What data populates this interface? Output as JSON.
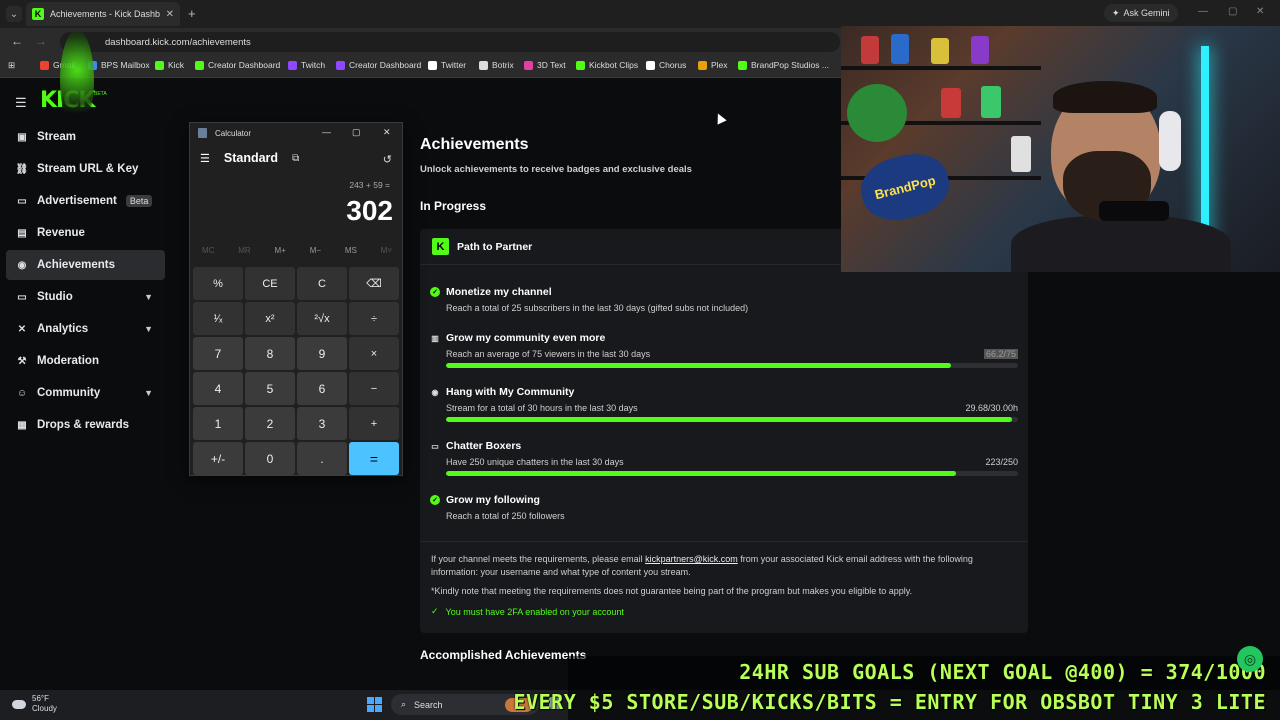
{
  "browser": {
    "tab_title": "Achievements - Kick Dashboard",
    "tab_close": "✕",
    "new_tab": "+",
    "ask_gemini": "Ask Gemini",
    "url": "dashboard.kick.com/achievements",
    "bookmarks": [
      {
        "label": "Gmail",
        "color": "#ea4335"
      },
      {
        "label": "BPS Mailbox",
        "color": "#4285f4"
      },
      {
        "label": "Kick",
        "color": "#53fc18"
      },
      {
        "label": "Creator Dashboard",
        "color": "#53fc18"
      },
      {
        "label": "Twitch",
        "color": "#9146ff"
      },
      {
        "label": "Creator Dashboard",
        "color": "#9146ff"
      },
      {
        "label": "Twitter",
        "color": "#ffffff"
      },
      {
        "label": "Botrix",
        "color": "#dddddd"
      },
      {
        "label": "3D Text",
        "color": "#e040a0"
      },
      {
        "label": "Kickbot Clips",
        "color": "#53fc18"
      },
      {
        "label": "Chorus",
        "color": "#ffffff"
      },
      {
        "label": "Plex",
        "color": "#e5a00d"
      },
      {
        "label": "BrandPop Studios ...",
        "color": "#53fc18"
      }
    ]
  },
  "sidebar": {
    "logo": "KICK",
    "logo_tag": "BETA",
    "items": [
      {
        "label": "Stream",
        "icon": "broadcast-icon",
        "glyph": "▣"
      },
      {
        "label": "Stream URL & Key",
        "icon": "link-icon",
        "glyph": "⛓"
      },
      {
        "label": "Advertisement",
        "icon": "ad-icon",
        "glyph": "▭",
        "badge": "Beta"
      },
      {
        "label": "Revenue",
        "icon": "wallet-icon",
        "glyph": "▤"
      },
      {
        "label": "Achievements",
        "icon": "trophy-icon",
        "glyph": "◉"
      },
      {
        "label": "Studio",
        "icon": "monitor-icon",
        "glyph": "▭"
      },
      {
        "label": "Analytics",
        "icon": "analytics-icon",
        "glyph": "✕"
      },
      {
        "label": "Moderation",
        "icon": "hammer-icon",
        "glyph": "⚒"
      },
      {
        "label": "Community",
        "icon": "users-icon",
        "glyph": "☺"
      },
      {
        "label": "Drops & rewards",
        "icon": "gift-icon",
        "glyph": "▦"
      }
    ],
    "active": "Achievements"
  },
  "main": {
    "title": "Achievements",
    "subtitle": "Unlock achievements to receive badges and exclusive deals",
    "in_progress": "In Progress",
    "card_title": "Path to Partner",
    "achievements": [
      {
        "name": "Monetize my channel",
        "desc": "Reach a total of 25 subscribers in the last 30 days (gifted subs not included)",
        "status": "done"
      },
      {
        "name": "Grow my community even more",
        "desc": "Reach an average of 75 viewers in the last 30 days",
        "value": "66.2/75",
        "progress": 0.883,
        "status": "progress"
      },
      {
        "name": "Hang with My Community",
        "desc": "Stream for a total of 30 hours in the last 30 days",
        "value": "29.68/30.00h",
        "progress": 0.989,
        "status": "progress"
      },
      {
        "name": "Chatter Boxers",
        "desc": "Have 250 unique chatters in the last 30 days",
        "value": "223/250",
        "progress": 0.892,
        "status": "progress"
      },
      {
        "name": "Grow my following",
        "desc": "Reach a total of 250 followers",
        "status": "done"
      }
    ],
    "note_prefix": "If your channel meets the requirements, please email ",
    "note_email": "kickpartners@kick.com",
    "note_suffix": " from your associated Kick email address with the following information: your username and what type of content you stream.",
    "note_disclaimer": "*Kindly note that meeting the requirements does not guarantee being part of the program but makes you eligible to apply.",
    "twofa": "You must have 2FA enabled on your account",
    "accomplished": "Accomplished Achievements"
  },
  "calculator": {
    "title": "Calculator",
    "mode": "Standard",
    "expression": "243 + 59 =",
    "display": "302",
    "memory": [
      "MC",
      "MR",
      "M+",
      "M−",
      "MS",
      "M˅"
    ],
    "keys": [
      "%",
      "CE",
      "C",
      "⌫",
      "¹⁄ₓ",
      "x²",
      "²√x",
      "÷",
      "7",
      "8",
      "9",
      "×",
      "4",
      "5",
      "6",
      "−",
      "1",
      "2",
      "3",
      "+",
      "+/-",
      "0",
      ".",
      "="
    ]
  },
  "webcam": {
    "sticker": "BrandPop"
  },
  "taskbar": {
    "temp": "56°F",
    "condition": "Cloudy",
    "search": "Search"
  },
  "overlay": {
    "line1": "24HR SUB GOALS (NEXT GOAL @400) = 374/1000",
    "line2": "EVERY $5 STORE/SUB/KICKS/BITS = ENTRY FOR OBSBOT TINY 3 LITE"
  },
  "colors": {
    "accent": "#53fc18",
    "calc_equals": "#4cc2ff",
    "overlay_text": "#b8ff5a"
  }
}
